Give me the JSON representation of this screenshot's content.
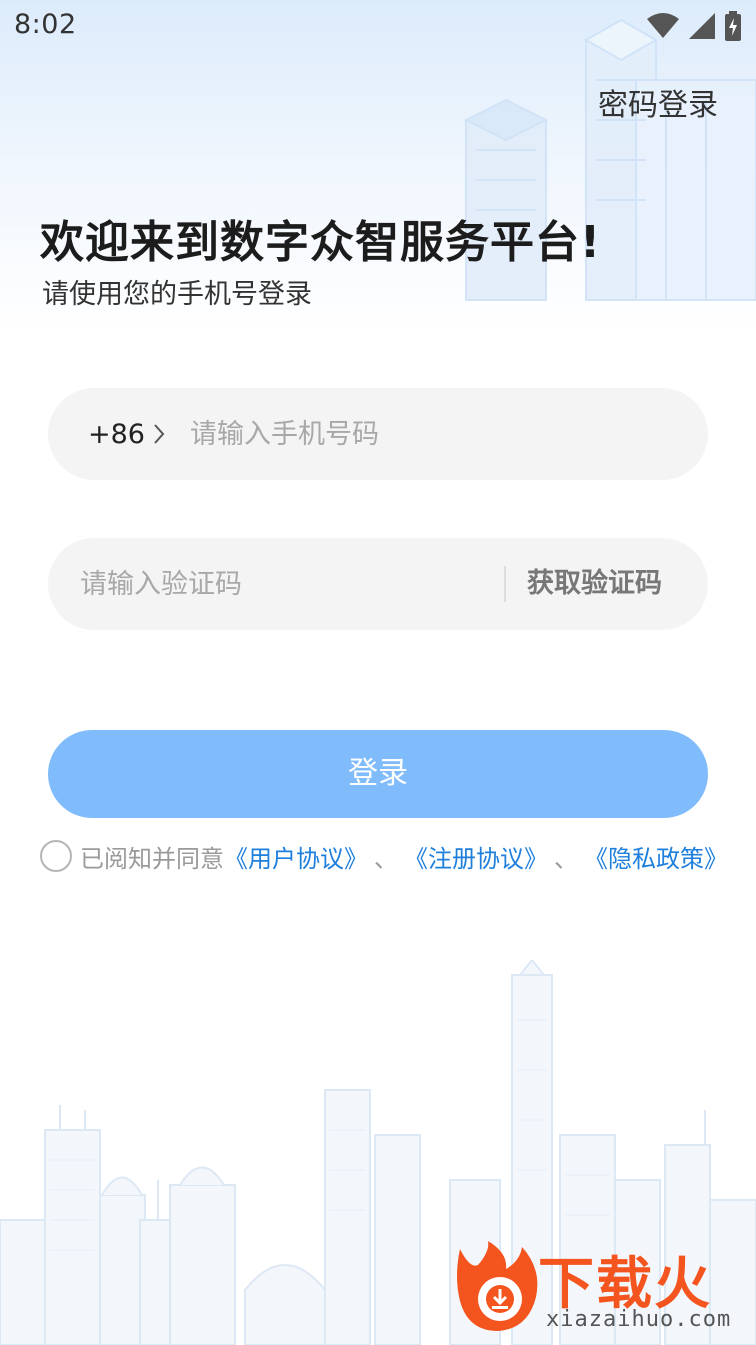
{
  "status_bar": {
    "time": "8:02",
    "icons": [
      "wifi-icon",
      "signal-icon",
      "battery-charging-icon"
    ]
  },
  "header": {
    "password_login": "密码登录"
  },
  "hero": {
    "title": "欢迎来到数字众智服务平台!",
    "subtitle": "请使用您的手机号登录"
  },
  "form": {
    "country_code": "+86",
    "phone_placeholder": "请输入手机号码",
    "phone_value": "",
    "code_placeholder": "请输入验证码",
    "code_value": "",
    "get_code_label": "获取验证码"
  },
  "login_button": {
    "label": "登录"
  },
  "agreement": {
    "checked": false,
    "prefix": "已阅知并同意",
    "user_agreement": "《用户协议》",
    "separator": "、",
    "register_agreement": "《注册协议》",
    "privacy_policy": "《隐私政策》"
  },
  "watermark": {
    "brand": "下载火",
    "url": "xiazaihuo.com"
  },
  "colors": {
    "primary_button": "#80bcfb",
    "link": "#1f7fdc",
    "input_bg": "#f4f4f4",
    "watermark": "#f4541e"
  }
}
